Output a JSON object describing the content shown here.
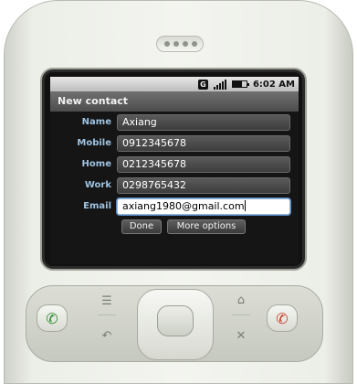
{
  "statusbar": {
    "network_badge": "G",
    "time": "6:02 AM",
    "signal_icon": "signal-bars-icon",
    "battery_icon": "battery-icon",
    "battery_level": 0.7
  },
  "screen": {
    "title": "New contact",
    "fields": [
      {
        "label": "Name",
        "value": "Axiang"
      },
      {
        "label": "Mobile",
        "value": "0912345678"
      },
      {
        "label": "Home",
        "value": "0212345678"
      },
      {
        "label": "Work",
        "value": "0298765432"
      },
      {
        "label": "Email",
        "value": "axiang1980@gmail.com"
      }
    ],
    "buttons": {
      "done": "Done",
      "more_options": "More options"
    }
  },
  "hardware": {
    "call_icon": "phone-call-icon",
    "end_icon": "phone-end-icon",
    "menu_icon": "menu-icon",
    "back_icon": "back-arrow-icon",
    "home_icon": "home-icon",
    "search_icon": "search-icon"
  },
  "colors": {
    "label": "#9ec3e2",
    "call": "#2b8a2b",
    "end": "#c43b2b"
  }
}
